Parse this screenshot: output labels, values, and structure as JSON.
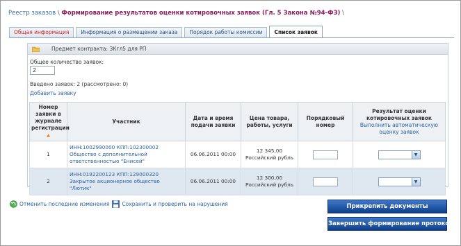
{
  "breadcrumb": {
    "link": "Реестр заказов",
    "separator": "\\",
    "title": "Формирование результатов оценки котировочных заявок (Гл. 5 Закона №94-ФЗ)",
    "trail_sep": "\\"
  },
  "tabs": [
    {
      "label": "Общая информация"
    },
    {
      "label": "Информация о размещении заказа"
    },
    {
      "label": "Порядок работы комиссии"
    },
    {
      "label": "Список заявок"
    }
  ],
  "panel": {
    "subject": "Предмет контракта: ЗКгл5 для РП",
    "count_label": "Общее количество заявок:",
    "count_value": "2",
    "entered": "Введено заявок: 2  (рассмотрено: 0)",
    "add_link": "Добавить заявку"
  },
  "table": {
    "headers": {
      "number": "Номер заявки в журнале регистрации",
      "participant": "Участник",
      "date": "Дата и время подачи заявки",
      "price": "Цена товара, работы, услуги",
      "order": "Порядковый номер",
      "result": "Результат оценки котировочных заявок",
      "auto_link": "Выполнить автоматическую оценку заявок"
    },
    "sort_arrow": "▲",
    "rows": [
      {
        "number": "1",
        "participant": "ИНН:1002990000 КПП:102300002 Общество с дополнительной ответственностью \"Енисей\"",
        "date": "06.06.2011 00:00",
        "price": "12 345,00",
        "currency": "Российский рубль"
      },
      {
        "number": "2",
        "participant": "ИНН:0192200123 КПП:129000320 Закрытое акционерное общество \"Лютик\"",
        "date": "06.06.2011 00:00",
        "price": "12 300,00",
        "currency": "Российский рубль"
      }
    ]
  },
  "actions": {
    "undo": "Отменить последние изменения",
    "save": "Сохранить и проверить на нарушения",
    "attach": "Прикрепить документы",
    "finish": "Завершить формирование протокола"
  },
  "icons": {
    "folder": "folder-icon",
    "undo": "undo-icon",
    "save": "floppy-disk-icon",
    "dropdown": "chevron-down-icon"
  },
  "colors": {
    "accent_blue": "#2a62a6",
    "title_purple": "#8a1f5e",
    "tab_red": "#d21f1f",
    "button_blue": "#1f56a8"
  }
}
